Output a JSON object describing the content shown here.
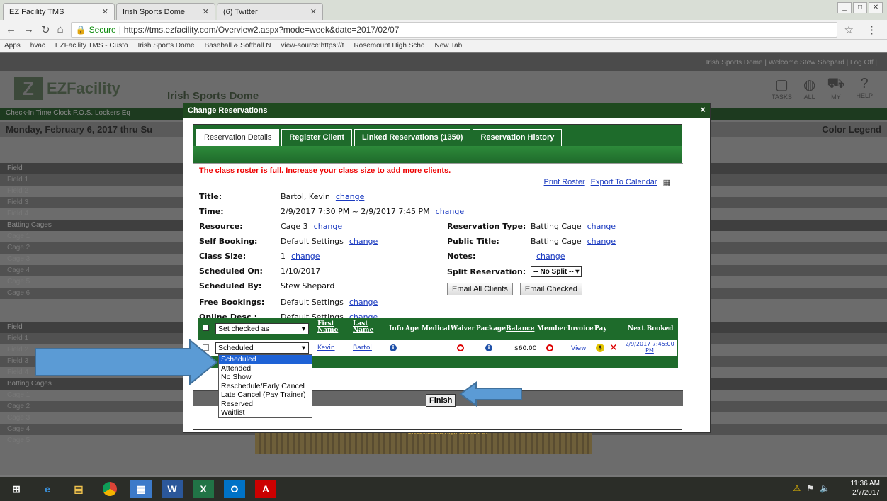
{
  "browser": {
    "tabs": [
      {
        "label": "EZ Facility TMS"
      },
      {
        "label": "Irish Sports Dome"
      },
      {
        "label": "(6) Twitter"
      }
    ],
    "url_secure": "Secure",
    "url": "https://tms.ezfacility.com/Overview2.aspx?mode=week&date=2017/02/07",
    "bookmarks": [
      "Apps",
      "hvac",
      "EZFacility TMS - Custo",
      "Irish Sports Dome",
      "Baseball & Softball N",
      "view-source:https://t",
      "Rosemount High Scho",
      "New Tab"
    ]
  },
  "page": {
    "top_links": "Irish Sports Dome   |   Welcome Stew Shepard   |   Log Off   |",
    "logo": "EZFacility",
    "venue": "Irish Sports Dome",
    "right_icons": [
      {
        "label": "TASKS"
      },
      {
        "label": "ALL"
      },
      {
        "label": "MY"
      },
      {
        "label": "HELP"
      }
    ],
    "menu": "Check-In   Time Clock   P.O.S.   Lockers   Eq",
    "date_range": "Monday, February 6, 2017 thru Su",
    "color_legend": "Color Legend",
    "rows": [
      {
        "label": "Field",
        "type": "head"
      },
      {
        "label": "Field 1"
      },
      {
        "label": "Field 2"
      },
      {
        "label": "Field 3"
      },
      {
        "label": "Field 4"
      },
      {
        "label": "Batting Cages",
        "type": "head"
      },
      {
        "label": "Cage 1"
      },
      {
        "label": "Cage 2"
      },
      {
        "label": "Cage 3"
      },
      {
        "label": "Cage 4"
      },
      {
        "label": "Cage 5"
      },
      {
        "label": "Cage 6"
      },
      {
        "label": "Field",
        "type": "head"
      },
      {
        "label": "Field 1"
      },
      {
        "label": "Field 2"
      },
      {
        "label": "Field 3"
      },
      {
        "label": "Field 4"
      },
      {
        "label": "Batting Cages",
        "type": "head"
      },
      {
        "label": "Cage 1"
      },
      {
        "label": "Cage 2"
      },
      {
        "label": "Cage 3"
      },
      {
        "label": "Cage 4"
      },
      {
        "label": "Cage 5"
      }
    ],
    "hatch_text": "ORosemount High ORSRAAA"
  },
  "modal": {
    "title": "Change Reservations",
    "close": "×",
    "tabs": [
      "Reservation Details",
      "Register Client",
      "Linked Reservations (1350)",
      "Reservation History"
    ],
    "warning": "The class roster is full. Increase your class size to add more clients.",
    "print_roster": "Print Roster",
    "export_calendar": "Export To Calendar",
    "fields": {
      "title_label": "Title:",
      "title_value": "Bartol, Kevin",
      "time_label": "Time:",
      "time_value": "2/9/2017 7:30 PM ~ 2/9/2017 7:45 PM",
      "resource_label": "Resource:",
      "resource_value": "Cage 3",
      "self_booking_label": "Self Booking:",
      "self_booking_value": "Default Settings",
      "class_size_label": "Class Size:",
      "class_size_value": "1",
      "scheduled_on_label": "Scheduled On:",
      "scheduled_on_value": "1/10/2017",
      "scheduled_by_label": "Scheduled By:",
      "scheduled_by_value": "Stew Shepard",
      "free_bookings_label": "Free Bookings:",
      "free_bookings_value": "Default Settings",
      "online_desc_label": "Online Desc.:",
      "online_desc_value": "Default Settings",
      "res_type_label": "Reservation Type:",
      "res_type_value": "Batting Cage",
      "public_title_label": "Public Title:",
      "public_title_value": "Batting Cage",
      "notes_label": "Notes:",
      "split_label": "Split Reservation:",
      "split_value": "-- No Split --"
    },
    "change": "change",
    "email_all": "Email All Clients",
    "email_checked": "Email Checked",
    "table": {
      "set_checked": "Set checked as",
      "headers": {
        "first": "First Name",
        "last": "Last Name",
        "info": "Info",
        "age": "Age",
        "medical": "Medical",
        "waiver": "Waiver",
        "package": "Package",
        "balance": "Balance",
        "member": "Member",
        "invoice": "Invoice",
        "pay": "Pay",
        "next": "Next Booked"
      },
      "row": {
        "status": "Scheduled",
        "first": "Kevin",
        "last": "Bartol",
        "balance": "$60.00",
        "invoice": "View",
        "next": "2/9/2017 7:45:00 PM"
      }
    },
    "finish": "Finish",
    "dropdown_options": [
      "Scheduled",
      "Attended",
      "No Show",
      "Reschedule/Early Cancel",
      "Late Cancel (Pay Trainer)",
      "Reserved",
      "Waitlist"
    ],
    "dropdown_selected": "Scheduled"
  },
  "taskbar": {
    "time": "11:36 AM",
    "date": "2/7/2017"
  }
}
